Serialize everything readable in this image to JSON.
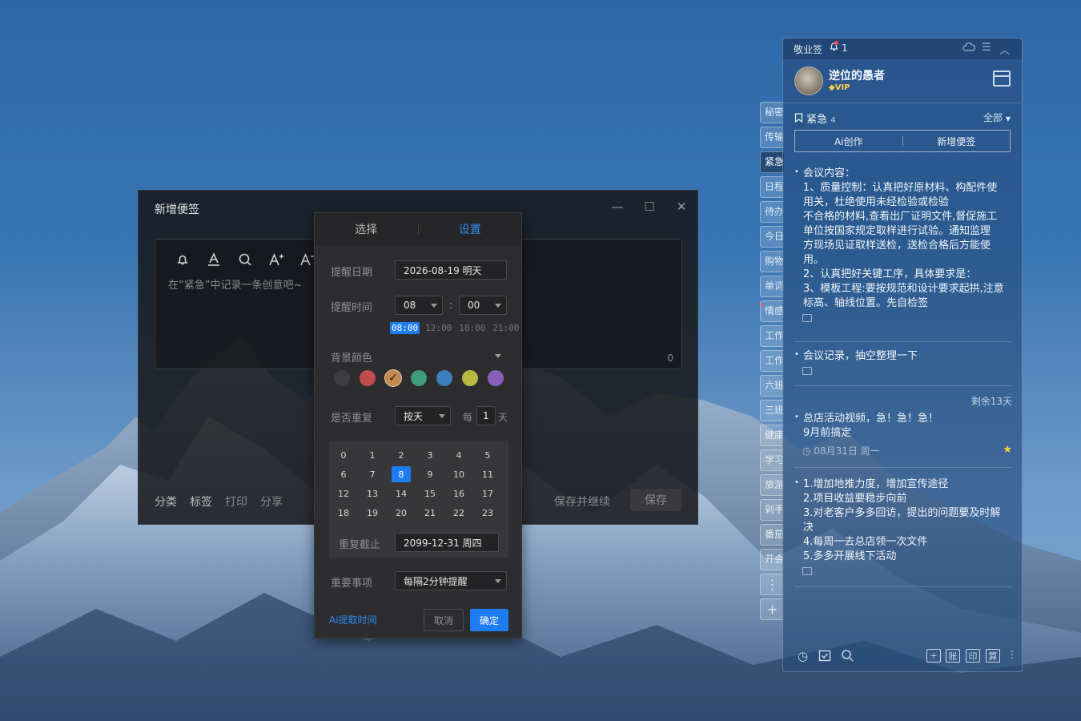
{
  "editor": {
    "title": "新增便签",
    "minimize": "—",
    "maximize": "☐",
    "close": "✕",
    "placeholder": "在“紧急”中记录一条创意吧~",
    "char_count": "0",
    "tools": [
      "bell-icon",
      "font-color-icon",
      "search-icon",
      "font-increase-icon",
      "font-decrease-icon"
    ],
    "bottom_links": [
      "分类",
      "标签",
      "打印",
      "分享"
    ],
    "save_continue": "保存并继续",
    "save": "保存"
  },
  "popup": {
    "tab_select": "选择",
    "tab_settings": "设置",
    "remind_date_label": "提醒日期",
    "remind_date_value": "2026-08-19 明天",
    "remind_time_label": "提醒时间",
    "hour": "08",
    "minute": "00",
    "colon": ":",
    "quick_times": [
      "08:00",
      "12:00",
      "18:00",
      "21:00"
    ],
    "quick_time_active": "08:00",
    "bg_color_label": "背景颜色",
    "colors": [
      "#3d3d40",
      "#c24b4b",
      "#c48a4d",
      "#3f9e7a",
      "#3b7fbf",
      "#b8b840",
      "#8a5fb8"
    ],
    "selected_color": "#c48a4d",
    "repeat_label": "是否重复",
    "repeat_value": "按天",
    "every_label": "每",
    "every_value": "1",
    "every_unit": "天",
    "hours_grid": [
      "0",
      "1",
      "2",
      "3",
      "4",
      "5",
      "6",
      "7",
      "8",
      "9",
      "10",
      "11",
      "12",
      "13",
      "14",
      "15",
      "16",
      "17",
      "18",
      "19",
      "20",
      "21",
      "22",
      "23"
    ],
    "hour_active": "8",
    "repeat_end_label": "重复截止",
    "repeat_end_value": "2099-12-31 周四",
    "important_label": "重要事项",
    "important_value": "每隔2分钟提醒",
    "ai_link": "Ai提取时间",
    "cancel": "取消",
    "confirm": "确定"
  },
  "sidetabs": [
    {
      "label": "秘密",
      "active": false
    },
    {
      "label": "传输",
      "active": false
    },
    {
      "label": "紧急",
      "active": true
    },
    {
      "label": "日程",
      "active": false
    },
    {
      "label": "待办",
      "active": false
    },
    {
      "label": "今日",
      "active": false
    },
    {
      "label": "购物",
      "active": false
    },
    {
      "label": "单词",
      "active": false
    },
    {
      "label": "情感",
      "active": false,
      "dot": true
    },
    {
      "label": "工作",
      "active": false
    },
    {
      "label": "工作",
      "active": false
    },
    {
      "label": "六班",
      "active": false
    },
    {
      "label": "三班",
      "active": false
    },
    {
      "label": "健康",
      "active": false
    },
    {
      "label": "学习",
      "active": false
    },
    {
      "label": "旅游",
      "active": false
    },
    {
      "label": "剁手",
      "active": false
    },
    {
      "label": "番茄",
      "active": false
    },
    {
      "label": "开会",
      "active": false
    }
  ],
  "sidetab_more": "⋮",
  "sidetab_add": "+",
  "panel": {
    "app_name": "敬业签",
    "notification_count": "1",
    "username": "逆位的愚者",
    "vip": "VIP",
    "category": "紧急",
    "category_count": "4",
    "filter": "全部",
    "ai_create": "Ai创作",
    "new_note": "新增便签",
    "notes": [
      {
        "lines": [
          "会议内容：",
          "1、质量控制：认真把好原材料、构配件使",
          "用关，杜绝使用未经检验或检验",
          "不合格的材料,查看出厂证明文件,督促施工",
          "单位按国家规定取样进行试验。通知监理",
          "方现场见证取样送检，送检合格后方能使",
          "用。",
          "2、认真把好关键工序，具体要求是：",
          "3、模板工程:要按规范和设计要求起拱,注意",
          "标高、轴线位置。先自检签"
        ]
      },
      {
        "lines": [
          "会议记录，抽空整理一下"
        ]
      },
      {
        "remaining": "剩余13天",
        "lines": [
          "总店活动视频，急！急！急！",
          "9月前搞定"
        ],
        "date": "08月31日 周一"
      },
      {
        "lines": [
          "1.增加地推力度，增加宣传途径",
          "2.项目收益要稳步向前",
          "3.对老客户多多回访，提出的问题要及时解",
          "决",
          "4.每周一去总店领一次文件",
          "5.多多开展线下活动"
        ]
      }
    ],
    "footer_left": [
      "clock-icon",
      "checkbox-icon",
      "search-icon"
    ],
    "footer_right": [
      "+",
      "账",
      "印",
      "算"
    ]
  }
}
